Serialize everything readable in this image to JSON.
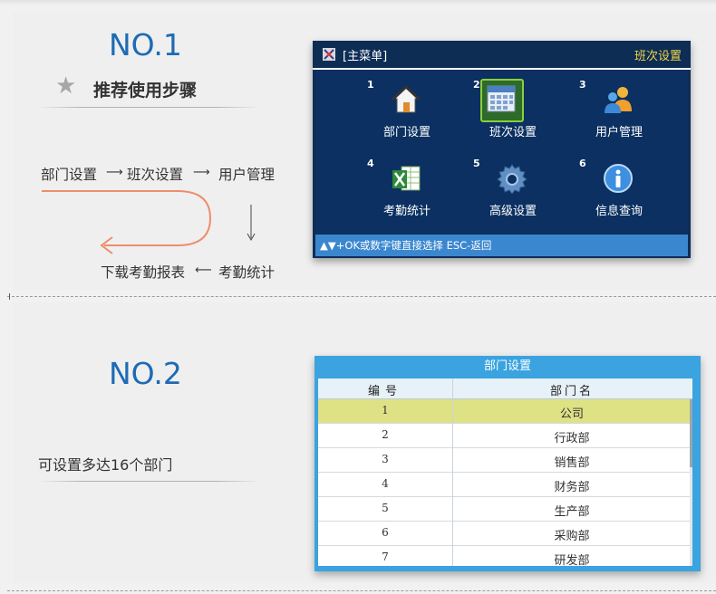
{
  "section1": {
    "number": "NO.1",
    "subtitle": "推荐使用步骤",
    "flow": {
      "step1": "部门设置",
      "step2": "班次设置",
      "step3": "用户管理",
      "step4": "考勤统计",
      "step5": "下载考勤报表"
    },
    "screen": {
      "title": "[主菜单]",
      "selected_label": "班次设置",
      "items": [
        {
          "num": "1",
          "label": "部门设置",
          "icon": "house-icon"
        },
        {
          "num": "2",
          "label": "班次设置",
          "icon": "calendar-icon"
        },
        {
          "num": "3",
          "label": "用户管理",
          "icon": "users-icon"
        },
        {
          "num": "4",
          "label": "考勤统计",
          "icon": "excel-icon"
        },
        {
          "num": "5",
          "label": "高级设置",
          "icon": "gear-icon"
        },
        {
          "num": "6",
          "label": "信息查询",
          "icon": "info-icon"
        }
      ],
      "footer": "▲▼+OK或数字键直接选择 ESC-返回"
    }
  },
  "section2": {
    "number": "NO.2",
    "description": "可设置多达16个部门",
    "screen": {
      "title": "部门设置",
      "headers": [
        "编号",
        "部门名"
      ],
      "rows": [
        {
          "id": "1",
          "name": "公司",
          "selected": true
        },
        {
          "id": "2",
          "name": "行政部"
        },
        {
          "id": "3",
          "name": "销售部"
        },
        {
          "id": "4",
          "name": "财务部"
        },
        {
          "id": "5",
          "name": "生产部"
        },
        {
          "id": "6",
          "name": "采购部"
        },
        {
          "id": "7",
          "name": "研发部"
        }
      ]
    }
  },
  "colors": {
    "accent_title": "#1e6bb4",
    "screen_bg": "#0b3061",
    "footer_bar": "#3b87cf",
    "selected_row": "#dfe185",
    "header_highlight": "#f2d64a"
  }
}
